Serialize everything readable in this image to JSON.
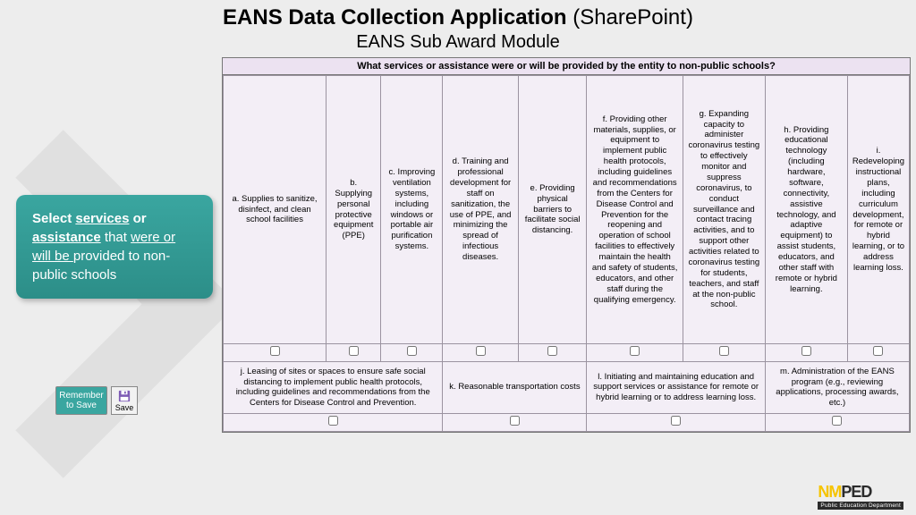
{
  "title_bold": "EANS Data Collection Application",
  "title_paren": " (SharePoint)",
  "subtitle": "EANS Sub Award Module",
  "callout": {
    "pre": "Select ",
    "u1": "services",
    "mid1": " or ",
    "u2": "assistance",
    "mid2": " that ",
    "u3": "were or will be ",
    "post": "provided to non-public schools"
  },
  "hint": {
    "remember": "Remember to Save",
    "save": "Save"
  },
  "table": {
    "header": "What services or assistance were or will be provided by the entity to non-public schools?",
    "row1": [
      "a. Supplies to sanitize, disinfect, and clean school facilities",
      "b. Supplying personal protective equipment (PPE)",
      "c. Improving ventilation systems, including windows or portable air purification systems.",
      "d. Training and professional development for staff on sanitization, the use of PPE, and minimizing the spread of infectious diseases.",
      "e. Providing physical barriers to facilitate social distancing.",
      "f. Providing other materials, supplies, or equipment to implement public health protocols, including guidelines and recommendations from the Centers for Disease Control and Prevention for the reopening and operation of school facilities to effectively maintain the health and safety of students, educators, and other staff during the qualifying emergency.",
      "g. Expanding capacity to administer coronavirus testing to effectively monitor and suppress coronavirus, to conduct surveillance and contact tracing activities, and to support other activities related to coronavirus testing for students, teachers, and staff at the non-public school.",
      "h. Providing educational technology (including hardware, software, connectivity, assistive technology, and adaptive equipment) to assist students, educators, and other staff with remote or hybrid learning.",
      "i. Redeveloping instructional plans, including curriculum development, for remote or hybrid learning, or to address learning loss."
    ],
    "row3": [
      "j. Leasing of sites or spaces to ensure safe social distancing to implement public health protocols, including guidelines and recommendations from the Centers for Disease Control and Prevention.",
      "k. Reasonable transportation costs",
      "l. Initiating and maintaining education and support services or assistance for remote or hybrid learning or to address learning loss.",
      "m. Administration of the EANS program (e.g., reviewing applications, processing awards, etc.)"
    ]
  },
  "logo": {
    "nm": "NM",
    "ped": "PED",
    "sub": "Public Education Department"
  }
}
